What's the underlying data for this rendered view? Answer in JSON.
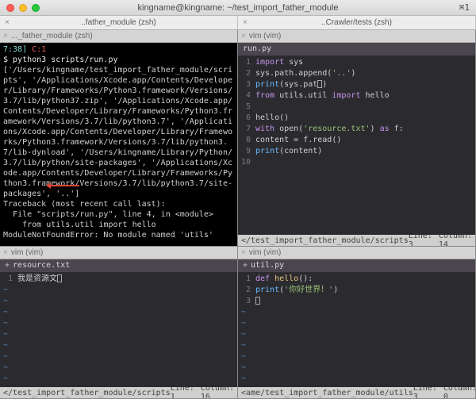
{
  "window": {
    "title": "kingname@kingname: ~/test_import_father_module",
    "icon": "⌘1"
  },
  "top_tabs": {
    "left": "..father_module (zsh)",
    "right": "..Crawler/tests (zsh)"
  },
  "pane_labels": {
    "topleft": "..._father_module (zsh)",
    "topright": "vim (vim)",
    "botleft": "vim (vim)",
    "botright": "vim (vim)"
  },
  "terminal": {
    "prompt_time": "7:38]",
    "prompt_path": "C:1",
    "cmd": "$ python3 scripts/run.py",
    "output": "['/Users/kingname/test_import_father_module/scripts', '/Applications/Xcode.app/Contents/Developer/Library/Frameworks/Python3.framework/Versions/3.7/lib/python37.zip', '/Applications/Xcode.app/Contents/Developer/Library/Frameworks/Python3.framework/Versions/3.7/lib/python3.7', '/Applications/Xcode.app/Contents/Developer/Library/Frameworks/Python3.framework/Versions/3.7/lib/python3.7/lib-dynload', '/Users/kingname/Library/Python/3.7/lib/python/site-packages', '/Applications/Xcode.app/Contents/Developer/Library/Frameworks/Python3.framework/Versions/3.7/lib/python3.7/site-packages', '..']",
    "tb1": "Traceback (most recent call last):",
    "tb2": "  File \"scripts/run.py\", line 4, in <module>",
    "tb3": "    from utils.util import hello",
    "tb4": "ModuleNotFoundError: No module named 'utils'"
  },
  "runpy": {
    "file": "run.py",
    "l1_kw": "import",
    "l1_m": " sys",
    "l2_a": "sys.path.append(",
    "l2_s": "'..'",
    "l2_b": ")",
    "l3_a": "print",
    "l3_b": "(sys.pat",
    "l3_c": ")",
    "l4_a": "from",
    "l4_b": " utils.util ",
    "l4_c": "import",
    "l4_d": " hello",
    "l6": "hello()",
    "l7_a": "with",
    "l7_b": " open(",
    "l7_s": "'resource.txt'",
    "l7_c": ") ",
    "l7_d": "as",
    "l7_e": " f:",
    "l8": "    content = f.read()",
    "l9_a": "    ",
    "l9_b": "print",
    "l9_c": "(content)",
    "status_path": "</test_import_father_module/scripts",
    "status_line": "Line: 3",
    "status_col": "Column: 14"
  },
  "resource": {
    "file": "resource.txt",
    "l1": "我是资源文",
    "status_path": "</test_import_father_module/scripts",
    "status_line": "Line: 1",
    "status_col": "Column: 16"
  },
  "util": {
    "file": "util.py",
    "l1_a": "def",
    "l1_b": " ",
    "l1_c": "hello",
    "l1_d": "():",
    "l2_a": "    ",
    "l2_b": "print",
    "l2_c": "(",
    "l2_s": "'你好世界！'",
    "l2_d": ")",
    "status_path": "<ame/test_import_father_module/utils",
    "status_line": "Line: 3",
    "status_col": "Column: 0"
  }
}
